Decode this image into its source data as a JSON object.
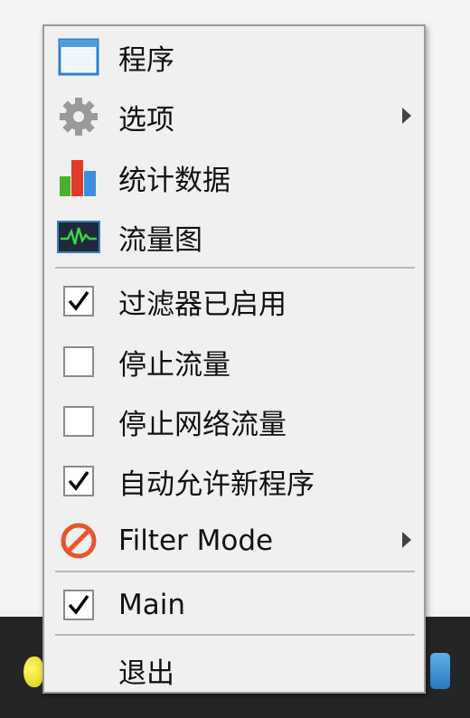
{
  "taskbar": {},
  "menu": {
    "items": [
      {
        "label": "程序",
        "icon": "window-icon"
      },
      {
        "label": "选项",
        "icon": "gear-icon",
        "submenu": true
      },
      {
        "label": "统计数据",
        "icon": "bar-chart-icon"
      },
      {
        "label": "流量图",
        "icon": "traffic-graph-icon"
      },
      {
        "label": "过滤器已启用",
        "checked": true
      },
      {
        "label": "停止流量",
        "checked": false
      },
      {
        "label": "停止网络流量",
        "checked": false
      },
      {
        "label": "自动允许新程序",
        "checked": true
      },
      {
        "label": "Filter Mode",
        "icon": "prohibited-icon",
        "submenu": true
      },
      {
        "label": "Main",
        "checked": true
      },
      {
        "label": "退出"
      }
    ]
  },
  "colors": {
    "menu_bg": "#f0f0f0",
    "taskbar_bg": "#252525",
    "filter_icon": "#e8552b"
  }
}
